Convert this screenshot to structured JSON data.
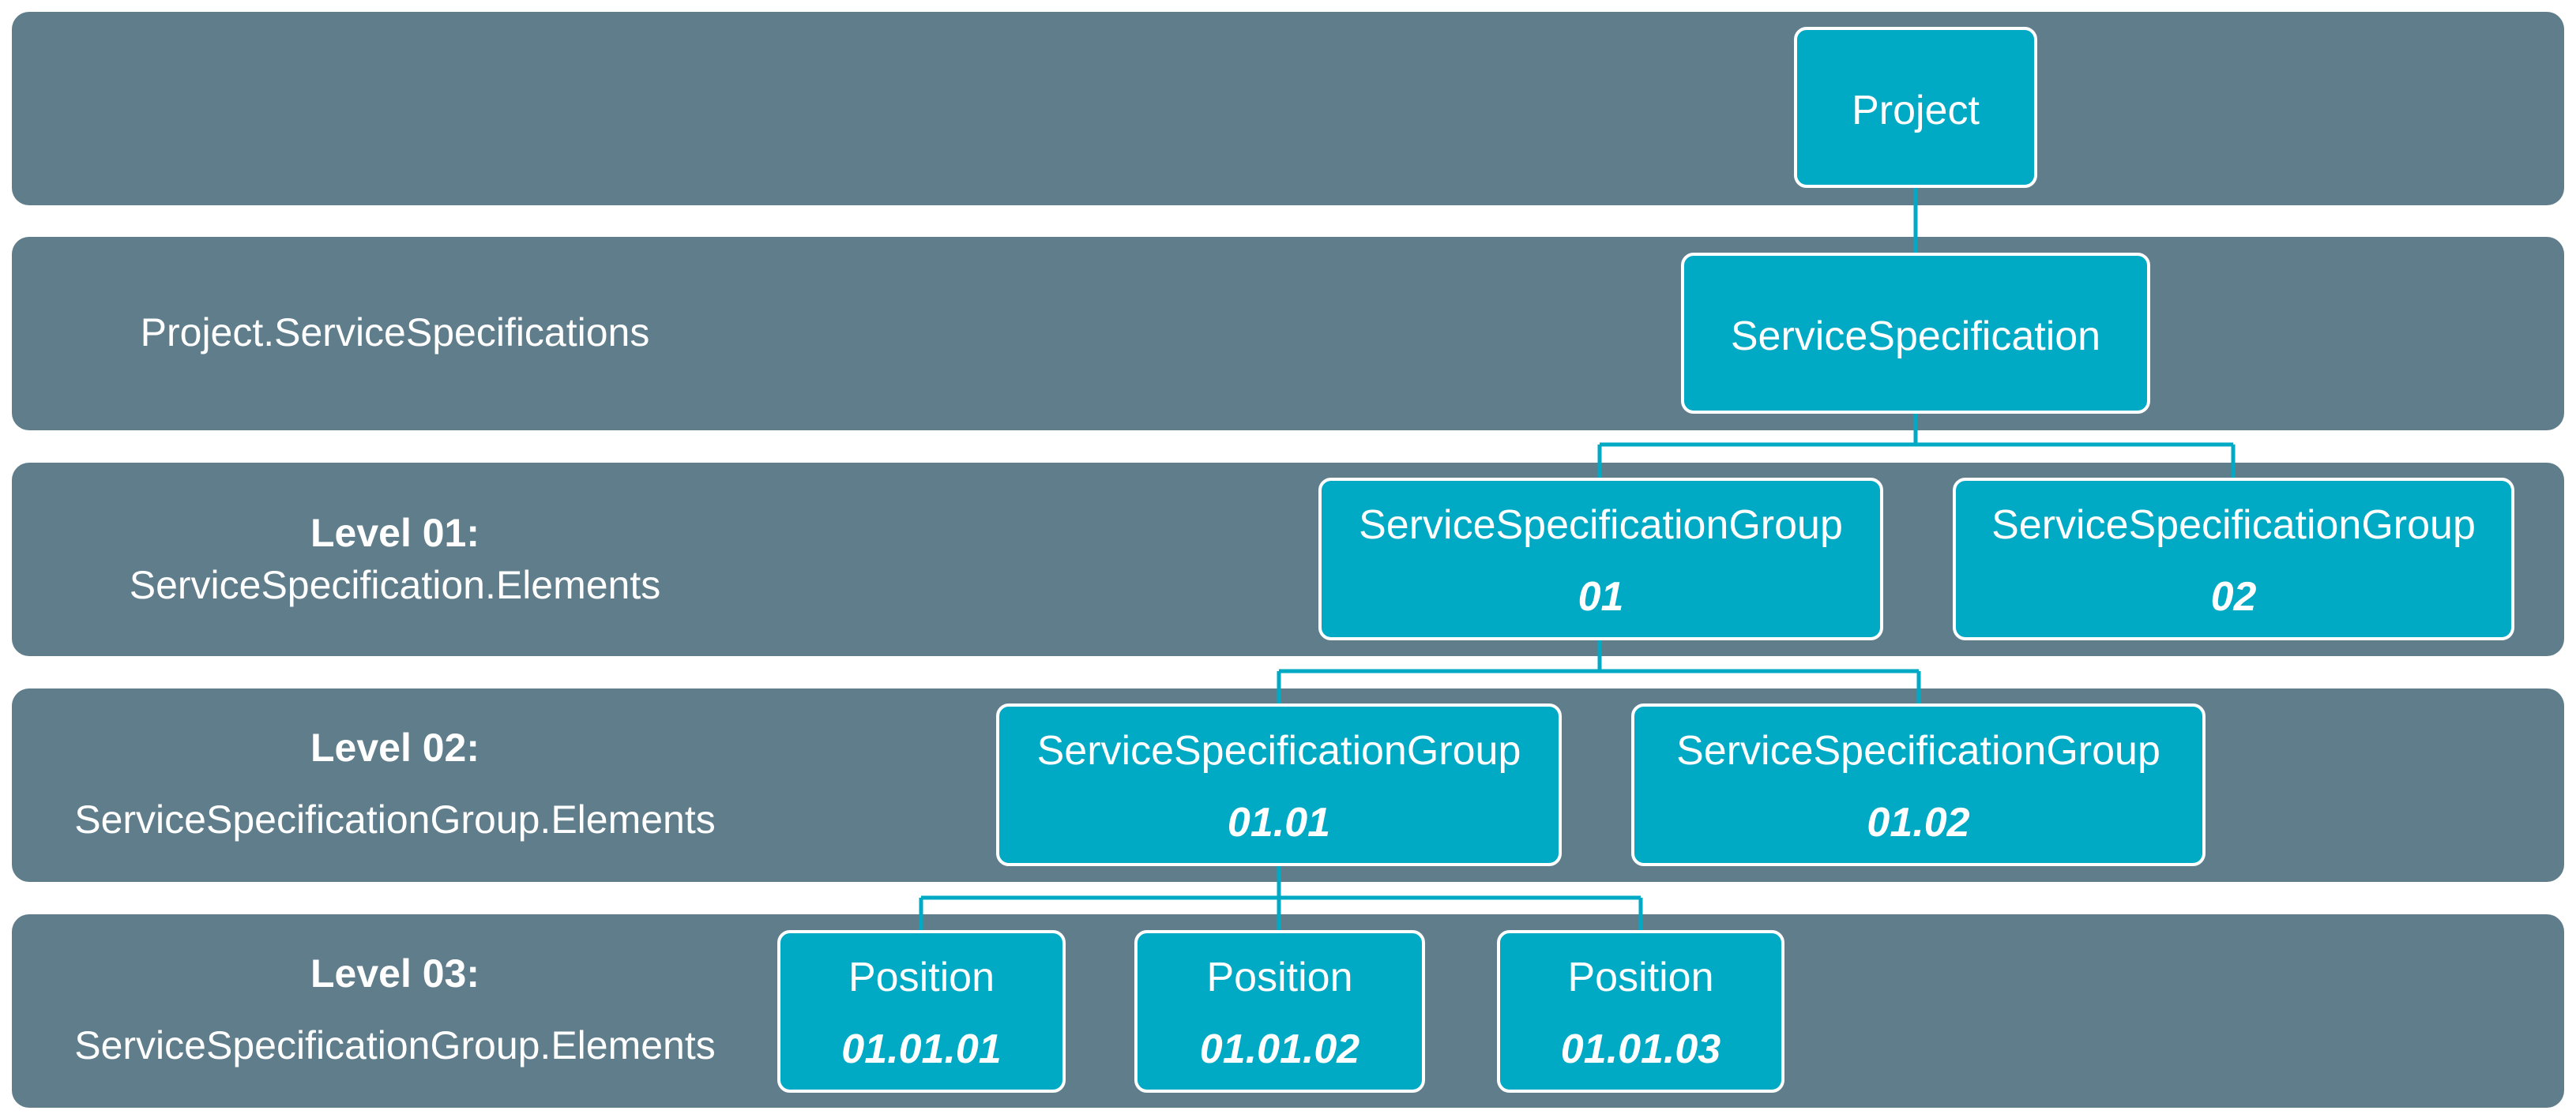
{
  "colors": {
    "band_background": "#607d8b",
    "node_fill": "#00a9c4",
    "node_border": "#ffffff",
    "connector": "#00a9c4",
    "text": "#ffffff"
  },
  "bands": [
    {
      "heading": "",
      "description": ""
    },
    {
      "heading": "",
      "description": "Project.ServiceSpecifications"
    },
    {
      "heading": "Level 01:",
      "description": "ServiceSpecification.Elements"
    },
    {
      "heading": "Level 02:",
      "description": "ServiceSpecificationGroup.Elements"
    },
    {
      "heading": "Level 03:",
      "description": "ServiceSpecificationGroup.Elements"
    }
  ],
  "nodes": {
    "project": {
      "name": "Project"
    },
    "service_specification": {
      "name": "ServiceSpecification"
    },
    "group_01": {
      "name": "ServiceSpecificationGroup",
      "code": "01"
    },
    "group_02": {
      "name": "ServiceSpecificationGroup",
      "code": "02"
    },
    "group_01_01": {
      "name": "ServiceSpecificationGroup",
      "code": "01.01"
    },
    "group_01_02": {
      "name": "ServiceSpecificationGroup",
      "code": "01.02"
    },
    "position_01_01_01": {
      "name": "Position",
      "code": "01.01.01"
    },
    "position_01_01_02": {
      "name": "Position",
      "code": "01.01.02"
    },
    "position_01_01_03": {
      "name": "Position",
      "code": "01.01.03"
    }
  }
}
